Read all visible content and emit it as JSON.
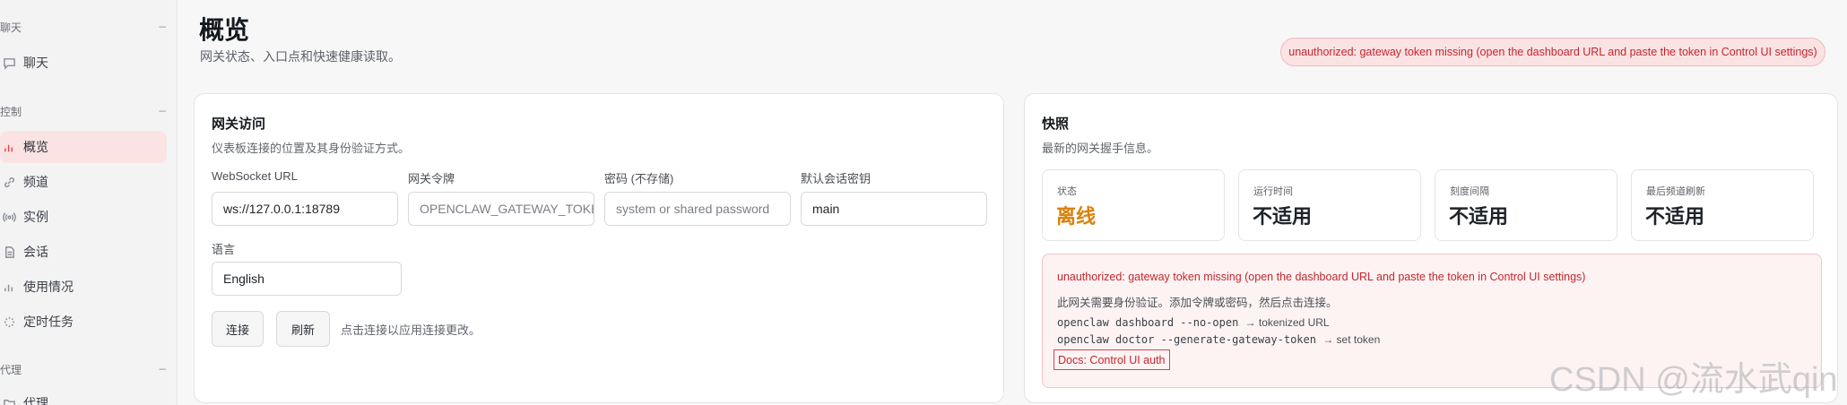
{
  "sidebar": {
    "sections": [
      {
        "title": "聊天",
        "collapse": "−"
      },
      {
        "title": "控制",
        "collapse": "−"
      },
      {
        "title": "代理",
        "collapse": "−"
      }
    ],
    "items": [
      {
        "label": "聊天",
        "icon": "chat-icon"
      },
      {
        "label": "概览",
        "icon": "bar-chart-icon",
        "active": true
      },
      {
        "label": "频道",
        "icon": "link-icon"
      },
      {
        "label": "实例",
        "icon": "broadcast-icon"
      },
      {
        "label": "会话",
        "icon": "document-icon"
      },
      {
        "label": "使用情况",
        "icon": "bar-chart-icon"
      },
      {
        "label": "定时任务",
        "icon": "loader-icon"
      },
      {
        "label": "代理",
        "icon": "folder-icon"
      }
    ]
  },
  "header": {
    "title": "概览",
    "subtitle": "网关状态、入口点和快速健康读取。",
    "alert": "unauthorized: gateway token missing (open the dashboard URL and paste the token in Control UI settings)"
  },
  "gateway": {
    "title": "网关访问",
    "subtitle": "仪表板连接的位置及其身份验证方式。",
    "fields": {
      "ws_label": "WebSocket URL",
      "ws_value": "ws://127.0.0.1:18789",
      "token_label": "网关令牌",
      "token_value": "OPENCLAW_GATEWAY_TOKEN",
      "password_label": "密码 (不存储)",
      "password_placeholder": "system or shared password",
      "session_label": "默认会话密钥",
      "session_value": "main",
      "lang_label": "语言",
      "lang_value": "English"
    },
    "connect_button": "连接",
    "refresh_button": "刷新",
    "hint": "点击连接以应用连接更改。"
  },
  "snapshot": {
    "title": "快照",
    "subtitle": "最新的网关握手信息。",
    "stats": [
      {
        "label": "状态",
        "value": "离线",
        "color": "#d9800b"
      },
      {
        "label": "运行时间",
        "value": "不适用"
      },
      {
        "label": "刻度间隔",
        "value": "不适用"
      },
      {
        "label": "最后频道刷新",
        "value": "不适用"
      }
    ],
    "error": {
      "message": "unauthorized: gateway token missing (open the dashboard URL and paste the token in Control UI settings)",
      "help": "此网关需要身份验证。添加令牌或密码，然后点击连接。",
      "cmd1": "openclaw dashboard --no-open",
      "cmd1_desc": "→ tokenized URL",
      "cmd2": "openclaw doctor --generate-gateway-token",
      "cmd2_desc": "→ set token",
      "docs_link": "Docs: Control UI auth"
    }
  },
  "watermark": "CSDN @流水武qin"
}
